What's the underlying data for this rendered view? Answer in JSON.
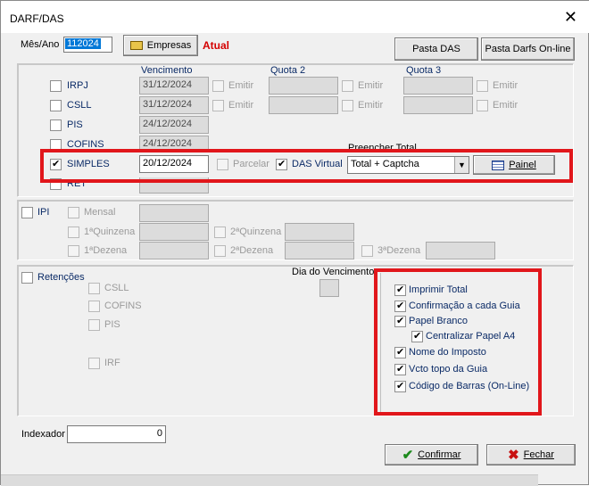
{
  "window": {
    "title": "DARF/DAS",
    "close_glyph": "✕"
  },
  "header": {
    "mes_ano_label": "Mês/Ano",
    "mes_ano_value": "112024",
    "empresas_button": "Empresas",
    "atual_label": "Atual",
    "pasta_das_button": "Pasta DAS",
    "pasta_darfs_button": "Pasta Darfs On-line"
  },
  "columns": {
    "vencimento": "Vencimento",
    "quota2": "Quota 2",
    "quota3": "Quota 3"
  },
  "taxes": [
    {
      "label": "IRPJ",
      "date": "31/12/2024",
      "emitir": "Emitir"
    },
    {
      "label": "CSLL",
      "date": "31/12/2024",
      "emitir": "Emitir"
    },
    {
      "label": "PIS",
      "date": "24/12/2024"
    },
    {
      "label": "COFINS",
      "date": "24/12/2024"
    },
    {
      "label": "SIMPLES",
      "date": "20/12/2024"
    },
    {
      "label": "RET",
      "date": ""
    }
  ],
  "simples_row": {
    "parcelar": "Parcelar",
    "das_virtual": "DAS Virtual",
    "preencher_total": "Preencher Total",
    "select_value": "Total + Captcha",
    "painel_button": "Painel"
  },
  "ipi": {
    "label": "IPI",
    "mensal": "Mensal",
    "q1": "1ªQuinzena",
    "q2": "2ªQuinzena",
    "d1": "1ªDezena",
    "d2": "2ªDezena",
    "d3": "3ªDezena"
  },
  "retencoes": {
    "label": "Retenções",
    "items": [
      "CSLL",
      "COFINS",
      "PIS",
      "IRF"
    ],
    "dia_vencimento": "Dia do Vencimento"
  },
  "options": [
    {
      "label": "Imprimir Total",
      "checked": true
    },
    {
      "label": "Confirmação a cada Guia",
      "checked": true
    },
    {
      "label": "Papel Branco",
      "checked": true
    },
    {
      "label": "Centralizar Papel A4",
      "checked": true
    },
    {
      "label": "Nome do Imposto",
      "checked": true
    },
    {
      "label": "Vcto topo da Guia",
      "checked": true
    },
    {
      "label": "Código de Barras (On-Line)",
      "checked": true
    }
  ],
  "footer": {
    "indexador_label": "Indexador",
    "indexador_value": "0",
    "confirmar_button": "Confirmar",
    "fechar_button": "Fechar"
  },
  "colors": {
    "highlight": "#e1161b",
    "label_text": "#0a2a66",
    "atual": "#d40000"
  }
}
